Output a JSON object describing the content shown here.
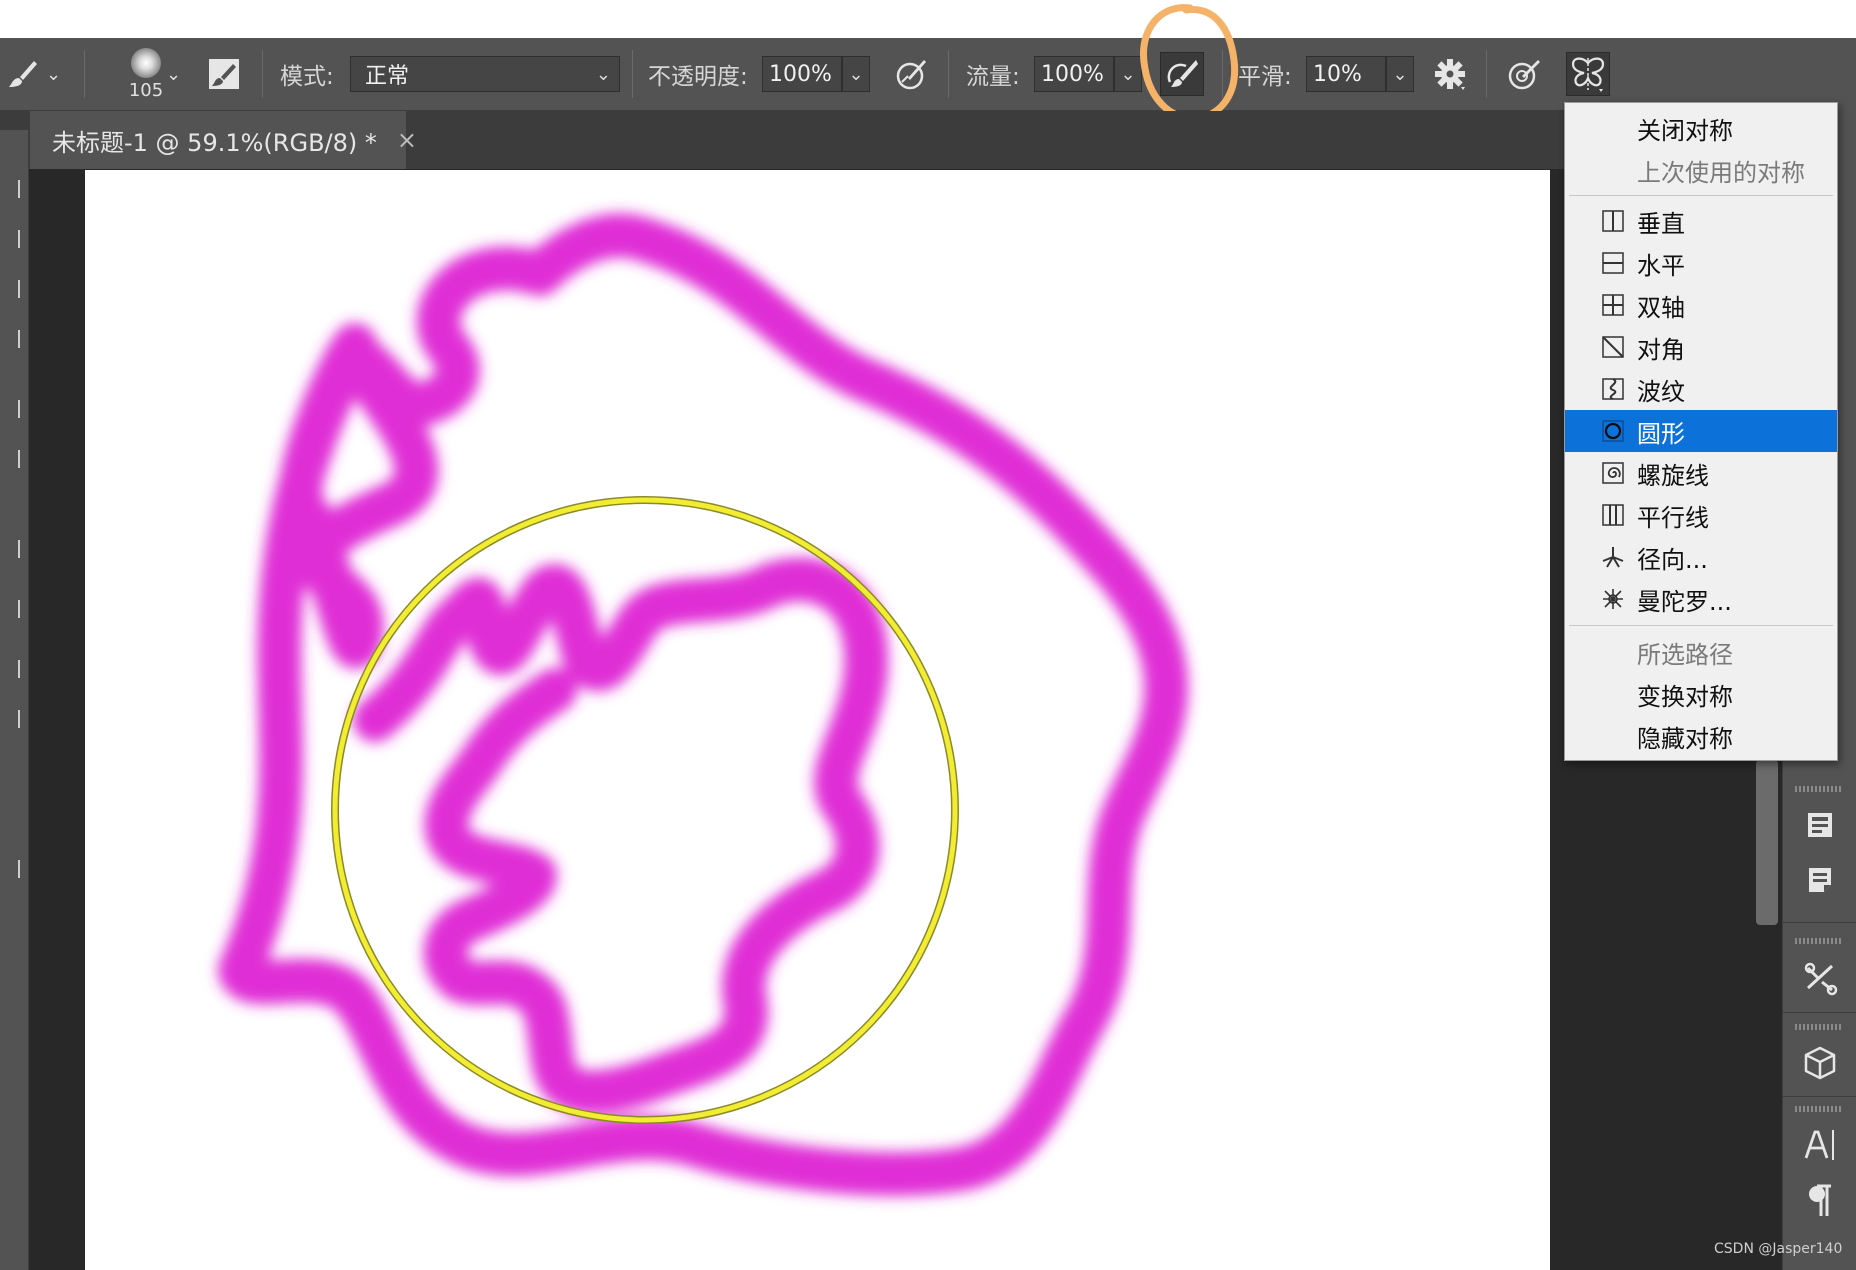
{
  "options_bar": {
    "brush_size": "105",
    "mode_label": "模式:",
    "mode_value": "正常",
    "opacity_label": "不透明度:",
    "opacity_value": "100%",
    "flow_label": "流量:",
    "flow_value": "100%",
    "smoothing_label": "平滑:",
    "smoothing_value": "10%",
    "icons": [
      "brush-tool-icon",
      "brush-preset-icon",
      "brush-settings-panel-icon",
      "opacity-pressure-icon",
      "airbrush-icon",
      "settings-gear-icon",
      "size-pressure-icon",
      "symmetry-butterfly-icon"
    ]
  },
  "document_tab": {
    "title": "未标题-1 @ 59.1%(RGB/8) *",
    "close": "×"
  },
  "symmetry_menu": {
    "items": [
      {
        "label": "关闭对称",
        "icon": "",
        "state": "normal"
      },
      {
        "label": "上次使用的对称",
        "icon": "",
        "state": "disabled"
      },
      {
        "label": "垂直",
        "icon": "vertical-symmetry-icon",
        "state": "normal"
      },
      {
        "label": "水平",
        "icon": "horizontal-symmetry-icon",
        "state": "normal"
      },
      {
        "label": "双轴",
        "icon": "dual-axis-symmetry-icon",
        "state": "normal"
      },
      {
        "label": "对角",
        "icon": "diagonal-symmetry-icon",
        "state": "normal"
      },
      {
        "label": "波纹",
        "icon": "wavy-symmetry-icon",
        "state": "normal"
      },
      {
        "label": "圆形",
        "icon": "circle-symmetry-icon",
        "state": "selected"
      },
      {
        "label": "螺旋线",
        "icon": "spiral-symmetry-icon",
        "state": "normal"
      },
      {
        "label": "平行线",
        "icon": "parallel-lines-symmetry-icon",
        "state": "normal"
      },
      {
        "label": "径向...",
        "icon": "radial-symmetry-icon",
        "state": "normal"
      },
      {
        "label": "曼陀罗...",
        "icon": "mandala-symmetry-icon",
        "state": "normal"
      },
      {
        "label": "所选路径",
        "icon": "",
        "state": "disabled"
      },
      {
        "label": "变换对称",
        "icon": "",
        "state": "normal"
      },
      {
        "label": "隐藏对称",
        "icon": "",
        "state": "normal"
      }
    ]
  },
  "colors": {
    "stroke": "#e02fd6",
    "symmetry_guide": "#f2ec33",
    "menu_highlight": "#0c71d9",
    "annotation": "#f5b36a"
  },
  "watermark": "CSDN @Jasper140"
}
